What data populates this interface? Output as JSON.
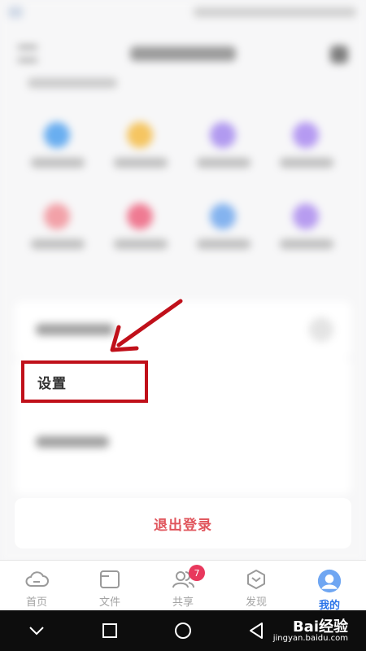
{
  "settings_menu": {
    "label": "设置"
  },
  "logout": {
    "label": "退出登录"
  },
  "tabs": [
    {
      "label": "首页",
      "icon": "cloud-icon",
      "active": false
    },
    {
      "label": "文件",
      "icon": "folder-icon",
      "active": false
    },
    {
      "label": "共享",
      "icon": "people-icon",
      "active": false,
      "badge": "7"
    },
    {
      "label": "发现",
      "icon": "discover-icon",
      "active": false
    },
    {
      "label": "我的",
      "icon": "avatar-icon",
      "active": true
    }
  ],
  "watermark": {
    "brand": "Bai经验",
    "url": "jingyan.baidu.com"
  },
  "colors": {
    "accent": "#2a73e8",
    "highlight_box": "#c0101a",
    "logout_text": "#e0555c",
    "badge": "#e8385d",
    "arrow": "#c0101a"
  }
}
